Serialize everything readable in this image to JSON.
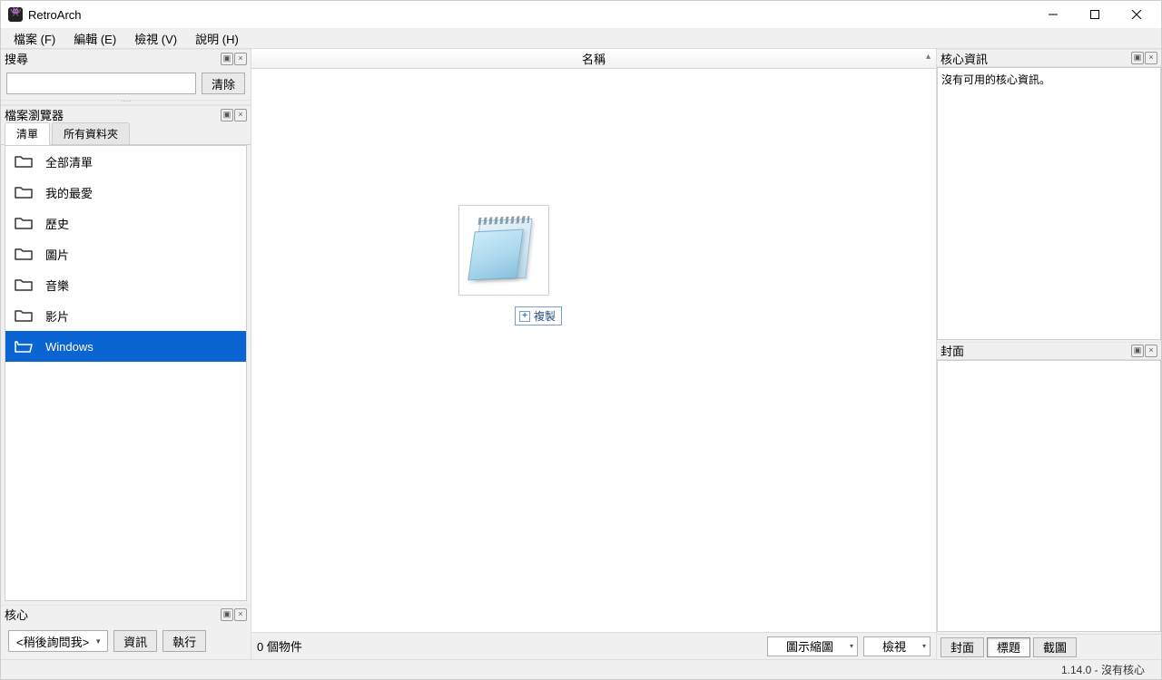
{
  "title": "RetroArch",
  "menu": {
    "file": "檔案 (F)",
    "edit": "編輯 (E)",
    "view": "檢視 (V)",
    "help": "說明 (H)"
  },
  "search": {
    "panel_title": "搜尋",
    "clear_btn": "清除"
  },
  "browser": {
    "panel_title": "檔案瀏覽器",
    "tabs": {
      "list": "清單",
      "all_folders": "所有資料夾"
    },
    "items": [
      {
        "label": "全部清單",
        "selected": false
      },
      {
        "label": "我的最愛",
        "selected": false
      },
      {
        "label": "歷史",
        "selected": false
      },
      {
        "label": "圖片",
        "selected": false
      },
      {
        "label": "音樂",
        "selected": false
      },
      {
        "label": "影片",
        "selected": false
      },
      {
        "label": "Windows",
        "selected": true
      }
    ]
  },
  "core": {
    "panel_title": "核心",
    "dropdown": "<稍後詢問我>",
    "info_btn": "資訊",
    "run_btn": "執行"
  },
  "center": {
    "col_header": "名稱",
    "drop_hint": "複製",
    "status_count": "0 個物件",
    "thumb_label": "圖示縮圖",
    "view_label": "檢視"
  },
  "right": {
    "core_info_title": "核心資訊",
    "core_info_text": "沒有可用的核心資訊。",
    "cover_title": "封面",
    "tabs": {
      "cover": "封面",
      "title": "標題",
      "screenshot": "截圖"
    }
  },
  "global_status": "1.14.0 - 沒有核心"
}
